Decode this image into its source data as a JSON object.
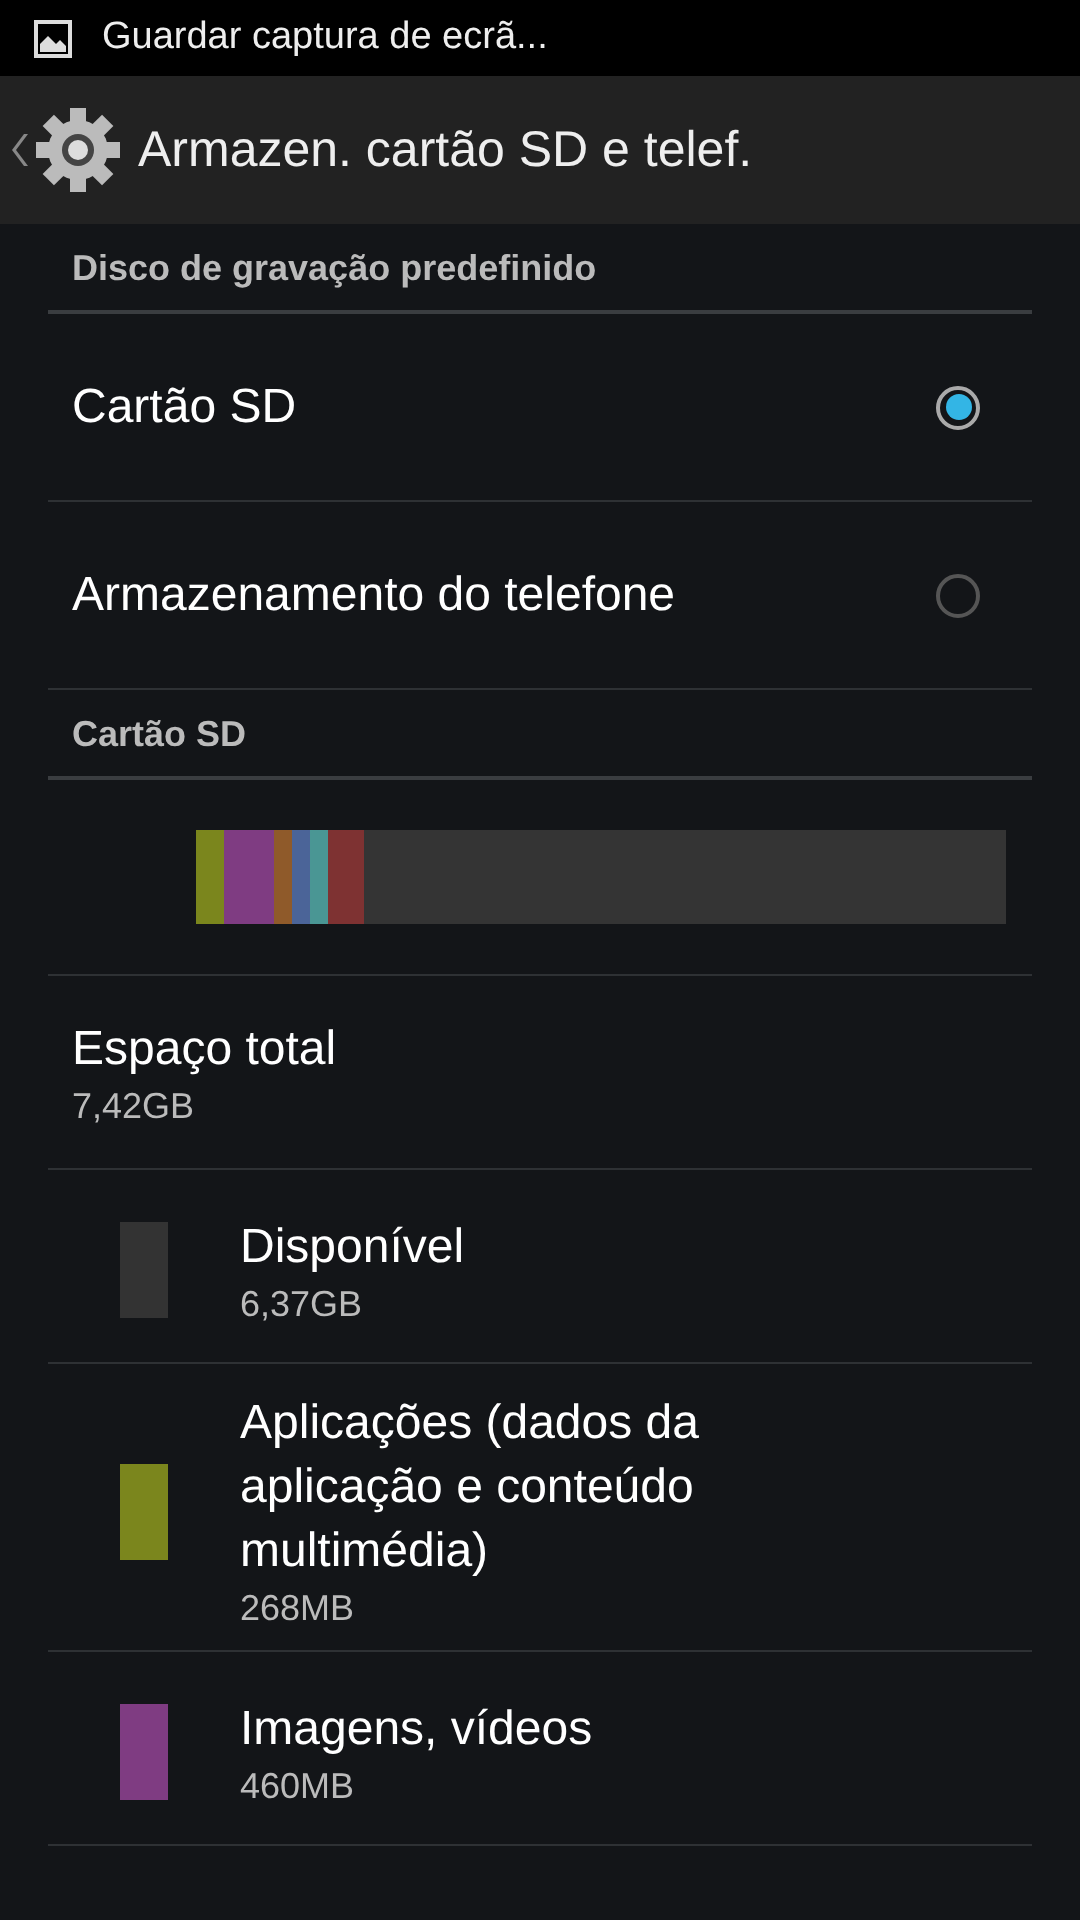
{
  "status_bar": {
    "notification": "Guardar captura de ecrã..."
  },
  "action_bar": {
    "title": "Armazen. cartão SD e telef."
  },
  "default_disk": {
    "header": "Disco de gravação predefinido",
    "options": [
      {
        "label": "Cartão SD",
        "selected": true
      },
      {
        "label": "Armazenamento do telefone",
        "selected": false
      }
    ]
  },
  "sd_card": {
    "header": "Cartão SD",
    "usage_bar": [
      {
        "color": "#7b861d"
      },
      {
        "color": "#7f3c82"
      },
      {
        "color": "#8f5a2a"
      },
      {
        "color": "#4b6498"
      },
      {
        "color": "#4a9694"
      },
      {
        "color": "#7e3232"
      }
    ],
    "total": {
      "label": "Espaço total",
      "value": "7,42GB"
    },
    "categories": [
      {
        "label": "Disponível",
        "value": "6,37GB",
        "color": "#333333"
      },
      {
        "label": "Aplicações (dados da aplicação e conteúdo multimédia)",
        "value": "268MB",
        "color": "#7b861d"
      },
      {
        "label": "Imagens, vídeos",
        "value": "460MB",
        "color": "#7f3c82"
      }
    ]
  }
}
